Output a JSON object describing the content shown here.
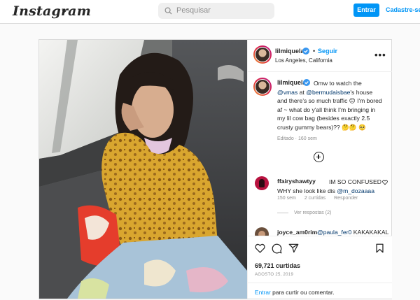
{
  "nav": {
    "logo": "Instagram",
    "search_placeholder": "Pesquisar",
    "login_label": "Entrar",
    "signup_label": "Cadastre-se"
  },
  "post": {
    "username": "lilmiquela",
    "follow_label": "Seguir",
    "separator": "•",
    "location": "Los Angeles, California",
    "more_label": "•••",
    "caption": {
      "username": "lilmiquela",
      "text_before": "Omw to watch the",
      "mention1": "@vmas",
      "text_mid": "at",
      "mention2": "@bermudaisbae",
      "text_after": "'s house and there's so much traffic 😑 I'm bored af ~ what do y'all think I'm bringing in my lil cow bag (besides exactly 2.5 crusty gummy bears)?? 🤔🤔 🥺",
      "meta": "Editado · 160 sem"
    },
    "comments": [
      {
        "username": "ffairyshawtyy",
        "text": "IM SO CONFUSED WHY she look like dis",
        "mention": "@m_dozaaaa",
        "age": "150 sem",
        "likes": "2 curtidas",
        "reply_label": "Responder",
        "view_replies": "Ver respostas (2)"
      },
      {
        "username": "joyce_am0rim",
        "mention": "@paula_fer0",
        "text": "KAKAKAKAL"
      }
    ],
    "likes_count": "69,721 curtidas",
    "date": "AGOSTO 25, 2019",
    "login_prompt": {
      "link": "Entrar",
      "text": "para curtir ou comentar."
    }
  }
}
